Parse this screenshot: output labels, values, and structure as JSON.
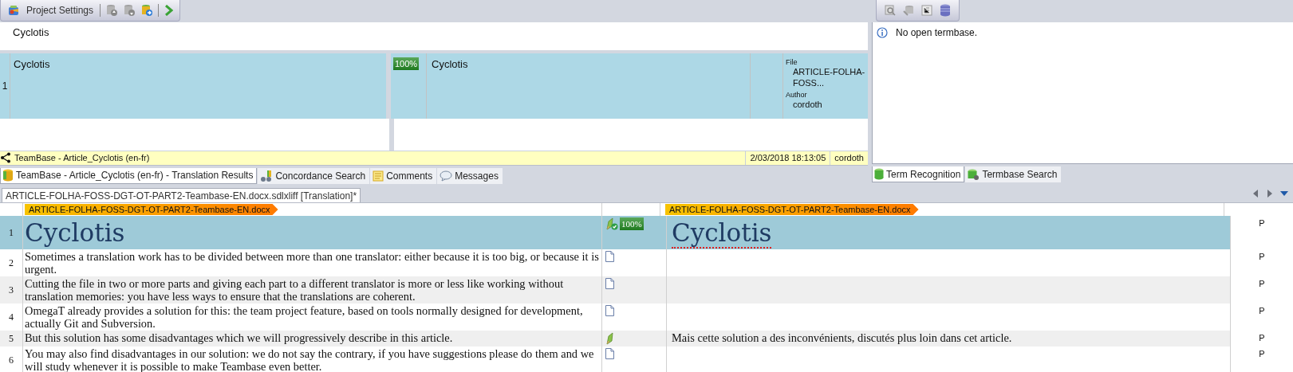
{
  "toolbar": {
    "label": "Project Settings"
  },
  "source_preview": "Cyclotis",
  "translation_results": {
    "rows": [
      {
        "number": "1",
        "source": "Cyclotis",
        "match": "100%",
        "target": "Cyclotis",
        "selected": true,
        "meta": [
          {
            "label": "File",
            "value": "ARTICLE-FOLHA-FOSS..."
          },
          {
            "label": "Author",
            "value": "cordoth"
          }
        ]
      }
    ],
    "status": {
      "name": "TeamBase - Article_Cyclotis (en-fr)",
      "date": "2/03/2018 18:13:05",
      "user": "cordoth"
    }
  },
  "panel_tabs": [
    {
      "label": "TeamBase - Article_Cyclotis (en-fr) - Translation Results",
      "selected": true
    },
    {
      "label": "Concordance Search",
      "selected": false
    },
    {
      "label": "Comments",
      "selected": false
    },
    {
      "label": "Messages",
      "selected": false
    }
  ],
  "termbase": {
    "message": "No open termbase.",
    "tabs": [
      {
        "label": "Term Recognition",
        "selected": true
      },
      {
        "label": "Termbase Search",
        "selected": false
      }
    ]
  },
  "document_tab": {
    "label": "ARTICLE-FOLHA-FOSS-DGT-OT-PART2-Teambase-EN.docx.sdlxliff [Translation]*",
    "selected": true
  },
  "editor": {
    "source_file": "ARTICLE-FOLHA-FOSS-DGT-OT-PART2-Teambase-EN.docx",
    "target_file": "ARTICLE-FOLHA-FOSS-DGT-OT-PART2-Teambase-EN.docx",
    "segments": [
      {
        "number": "1",
        "kind": "heading",
        "source": "Cyclotis",
        "target": "Cyclotis",
        "translated": true,
        "confirmed": true,
        "match": "100%",
        "selected": true,
        "spelling_error": true,
        "structure": "P"
      },
      {
        "number": "2",
        "kind": "body",
        "source": "Sometimes a translation work has to be divided between more than one translator: either because it is too big, or because it is urgent.",
        "translated": false,
        "selected": false,
        "structure": "P"
      },
      {
        "number": "3",
        "kind": "body",
        "source": "Cutting the file in two or more parts and giving each part to a different translator is more or less like working without translation memories: you have less ways to ensure that the translations are coherent.",
        "translated": false,
        "selected": false,
        "structure": "P"
      },
      {
        "number": "4",
        "kind": "body",
        "source": "OmegaT already provides a solution for this: the team project feature, based on tools normally designed for development, actually Git and Subversion.",
        "translated": false,
        "selected": false,
        "structure": "P"
      },
      {
        "number": "5",
        "kind": "body",
        "source": "But this solution has some disadvantages which we will progressively describe in this article.",
        "target": "Mais cette solution a des inconvénients, discutés plus loin dans cet article.",
        "translated": true,
        "confirmed": false,
        "selected": false,
        "spelling_error": false,
        "structure": "P"
      },
      {
        "number": "6",
        "kind": "body",
        "source": "You may also find disadvantages in our solution: we do not say the contrary, if you have suggestions please do them and we will study whenever it is possible to make Teambase even better.",
        "translated": false,
        "selected": false,
        "structure": "P"
      }
    ]
  }
}
